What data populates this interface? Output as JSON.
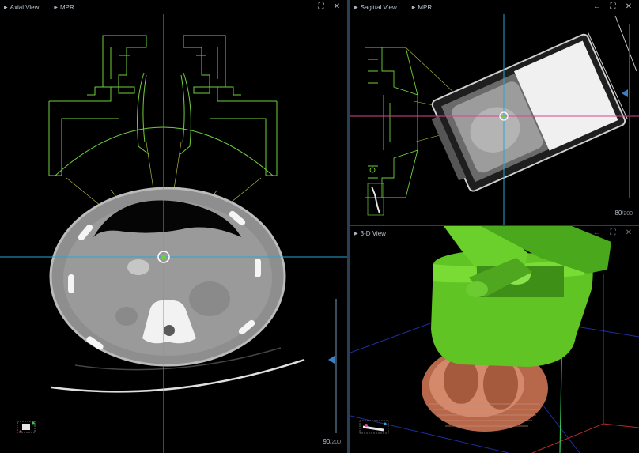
{
  "axial": {
    "title": "Axial View",
    "mode": "MPR",
    "slice": "90",
    "total": "/200",
    "slider_fraction": 0.45
  },
  "sagittal": {
    "title": "Sagittal View",
    "mode": "MPR",
    "slice": "80",
    "total": "/200",
    "slider_fraction": 0.4
  },
  "three_d": {
    "title": "3-D View"
  },
  "icons": {
    "expand": "⛶",
    "close": "✕",
    "back": "←"
  },
  "colors": {
    "crosshair_blue": "#2aa6d6",
    "crosshair_green": "#38c85a",
    "crosshair_pink": "#d9468a",
    "apparatus": "#6fcf3a",
    "accent": "#3d7fc2"
  }
}
